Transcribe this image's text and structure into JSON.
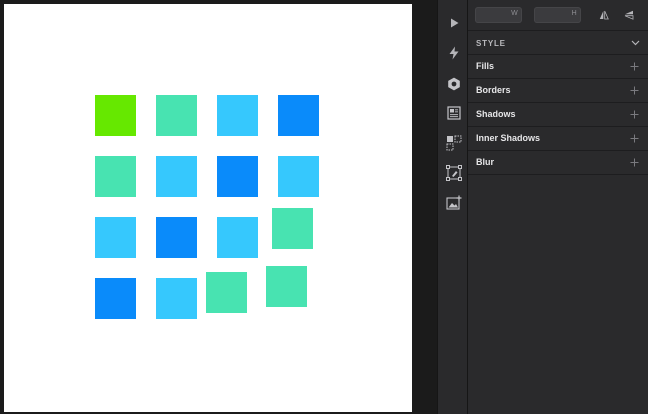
{
  "canvas": {
    "artboard_color": "#ffffff",
    "squares": [
      {
        "row": 0,
        "col": 0,
        "color": "#66e800"
      },
      {
        "row": 0,
        "col": 1,
        "color": "#48e3b1"
      },
      {
        "row": 0,
        "col": 2,
        "color": "#36c8fd"
      },
      {
        "row": 0,
        "col": 3,
        "color": "#0a8bfa"
      },
      {
        "row": 1,
        "col": 0,
        "color": "#48e3b1"
      },
      {
        "row": 1,
        "col": 1,
        "color": "#36c8fd"
      },
      {
        "row": 1,
        "col": 2,
        "color": "#0a8bfa"
      },
      {
        "row": 1,
        "col": 3,
        "color": "#36c8fd"
      },
      {
        "row": 2,
        "col": 0,
        "color": "#36c8fd"
      },
      {
        "row": 2,
        "col": 1,
        "color": "#0a8bfa"
      },
      {
        "row": 2,
        "col": 2,
        "color": "#36c8fd"
      },
      {
        "row": 2,
        "col": 3,
        "color": "#48e3b1"
      },
      {
        "row": 3,
        "col": 0,
        "color": "#0a8bfa"
      },
      {
        "row": 3,
        "col": 1,
        "color": "#36c8fd"
      },
      {
        "row": 3,
        "col": 2,
        "color": "#48e3b1"
      },
      {
        "row": 3,
        "col": 3,
        "color": "#48e3b1"
      }
    ]
  },
  "tool_rail": {
    "tools": [
      {
        "name": "play-icon",
        "interactable": true
      },
      {
        "name": "lightning-icon",
        "interactable": true
      },
      {
        "name": "component-icon",
        "interactable": true
      },
      {
        "name": "layout-icon",
        "interactable": true
      },
      {
        "name": "symbols-icon",
        "interactable": true
      },
      {
        "name": "edit-path-icon",
        "interactable": true
      },
      {
        "name": "add-image-icon",
        "interactable": true
      }
    ]
  },
  "inspector": {
    "width_suffix": "W",
    "height_suffix": "H",
    "style_title": "STYLE",
    "properties": [
      {
        "label": "Fills"
      },
      {
        "label": "Borders"
      },
      {
        "label": "Shadows"
      },
      {
        "label": "Inner Shadows"
      },
      {
        "label": "Blur"
      }
    ]
  },
  "colors": {
    "panel": "#2a2a2c",
    "text": "#e6e6e8",
    "muted": "#8e8e93"
  }
}
